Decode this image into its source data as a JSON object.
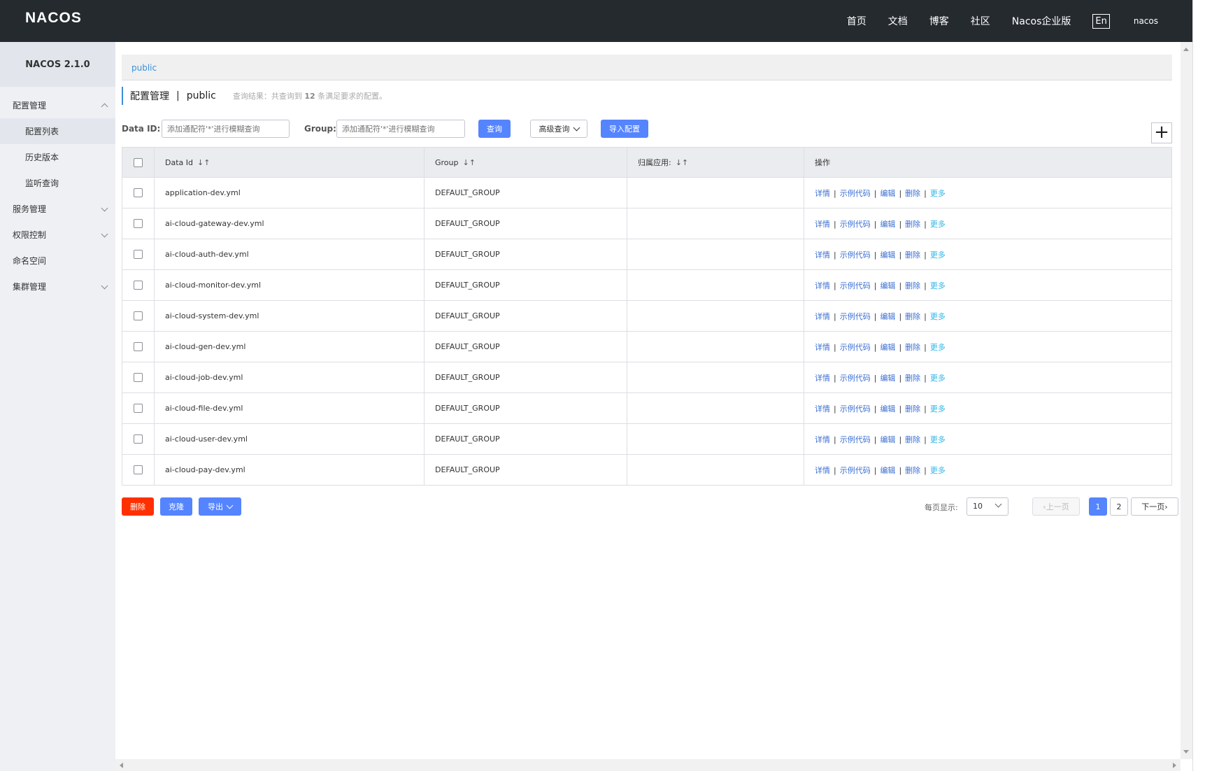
{
  "header": {
    "logo": "NACOS.",
    "nav": [
      "首页",
      "文档",
      "博客",
      "社区",
      "Nacos企业版"
    ],
    "lang": "En",
    "user": "nacos"
  },
  "sidebar": {
    "version": "NACOS 2.1.0",
    "items": [
      {
        "label": "配置管理",
        "expanded": true,
        "children": [
          "配置列表",
          "历史版本",
          "监听查询"
        ]
      },
      {
        "label": "服务管理",
        "expanded": false
      },
      {
        "label": "权限控制",
        "expanded": false
      },
      {
        "label": "命名空间"
      },
      {
        "label": "集群管理",
        "expanded": false
      }
    ]
  },
  "namespace_bar": "public",
  "title": {
    "main": "配置管理",
    "separator": "|",
    "namespace": "public",
    "result_prefix": "查询结果：共查询到",
    "result_count": "12",
    "result_suffix": "条满足要求的配置。"
  },
  "search": {
    "data_id_label": "Data ID:",
    "data_id_placeholder": "添加通配符'*'进行模糊查询",
    "group_label": "Group:",
    "group_placeholder": "添加通配符'*'进行模糊查询",
    "query_button": "查询",
    "advanced_button": "高级查询",
    "import_button": "导入配置",
    "add_button": "+"
  },
  "table": {
    "headers": [
      "Data Id",
      "Group",
      "归属应用:",
      "操作"
    ],
    "sort_glyph": "↓↑",
    "rows": [
      {
        "data_id": "application-dev.yml",
        "group": "DEFAULT_GROUP",
        "app": ""
      },
      {
        "data_id": "ai-cloud-gateway-dev.yml",
        "group": "DEFAULT_GROUP",
        "app": ""
      },
      {
        "data_id": "ai-cloud-auth-dev.yml",
        "group": "DEFAULT_GROUP",
        "app": ""
      },
      {
        "data_id": "ai-cloud-monitor-dev.yml",
        "group": "DEFAULT_GROUP",
        "app": ""
      },
      {
        "data_id": "ai-cloud-system-dev.yml",
        "group": "DEFAULT_GROUP",
        "app": ""
      },
      {
        "data_id": "ai-cloud-gen-dev.yml",
        "group": "DEFAULT_GROUP",
        "app": ""
      },
      {
        "data_id": "ai-cloud-job-dev.yml",
        "group": "DEFAULT_GROUP",
        "app": ""
      },
      {
        "data_id": "ai-cloud-file-dev.yml",
        "group": "DEFAULT_GROUP",
        "app": ""
      },
      {
        "data_id": "ai-cloud-user-dev.yml",
        "group": "DEFAULT_GROUP",
        "app": ""
      },
      {
        "data_id": "ai-cloud-pay-dev.yml",
        "group": "DEFAULT_GROUP",
        "app": ""
      }
    ],
    "ops": [
      "详情",
      "示例代码",
      "编辑",
      "删除",
      "更多"
    ]
  },
  "bottom": {
    "delete_button": "删除",
    "clone_button": "克隆",
    "export_button": "导出",
    "page_size_label": "每页显示:",
    "page_size": "10",
    "prev": "上一页",
    "pages": [
      "1",
      "2"
    ],
    "current_page": "1",
    "next": "下一页"
  },
  "colors": {
    "header_bg": "#252a2f",
    "primary": "#5584ff",
    "danger": "#ff3000",
    "link": "#3b6fd2",
    "more_link": "#2fb5e8"
  }
}
